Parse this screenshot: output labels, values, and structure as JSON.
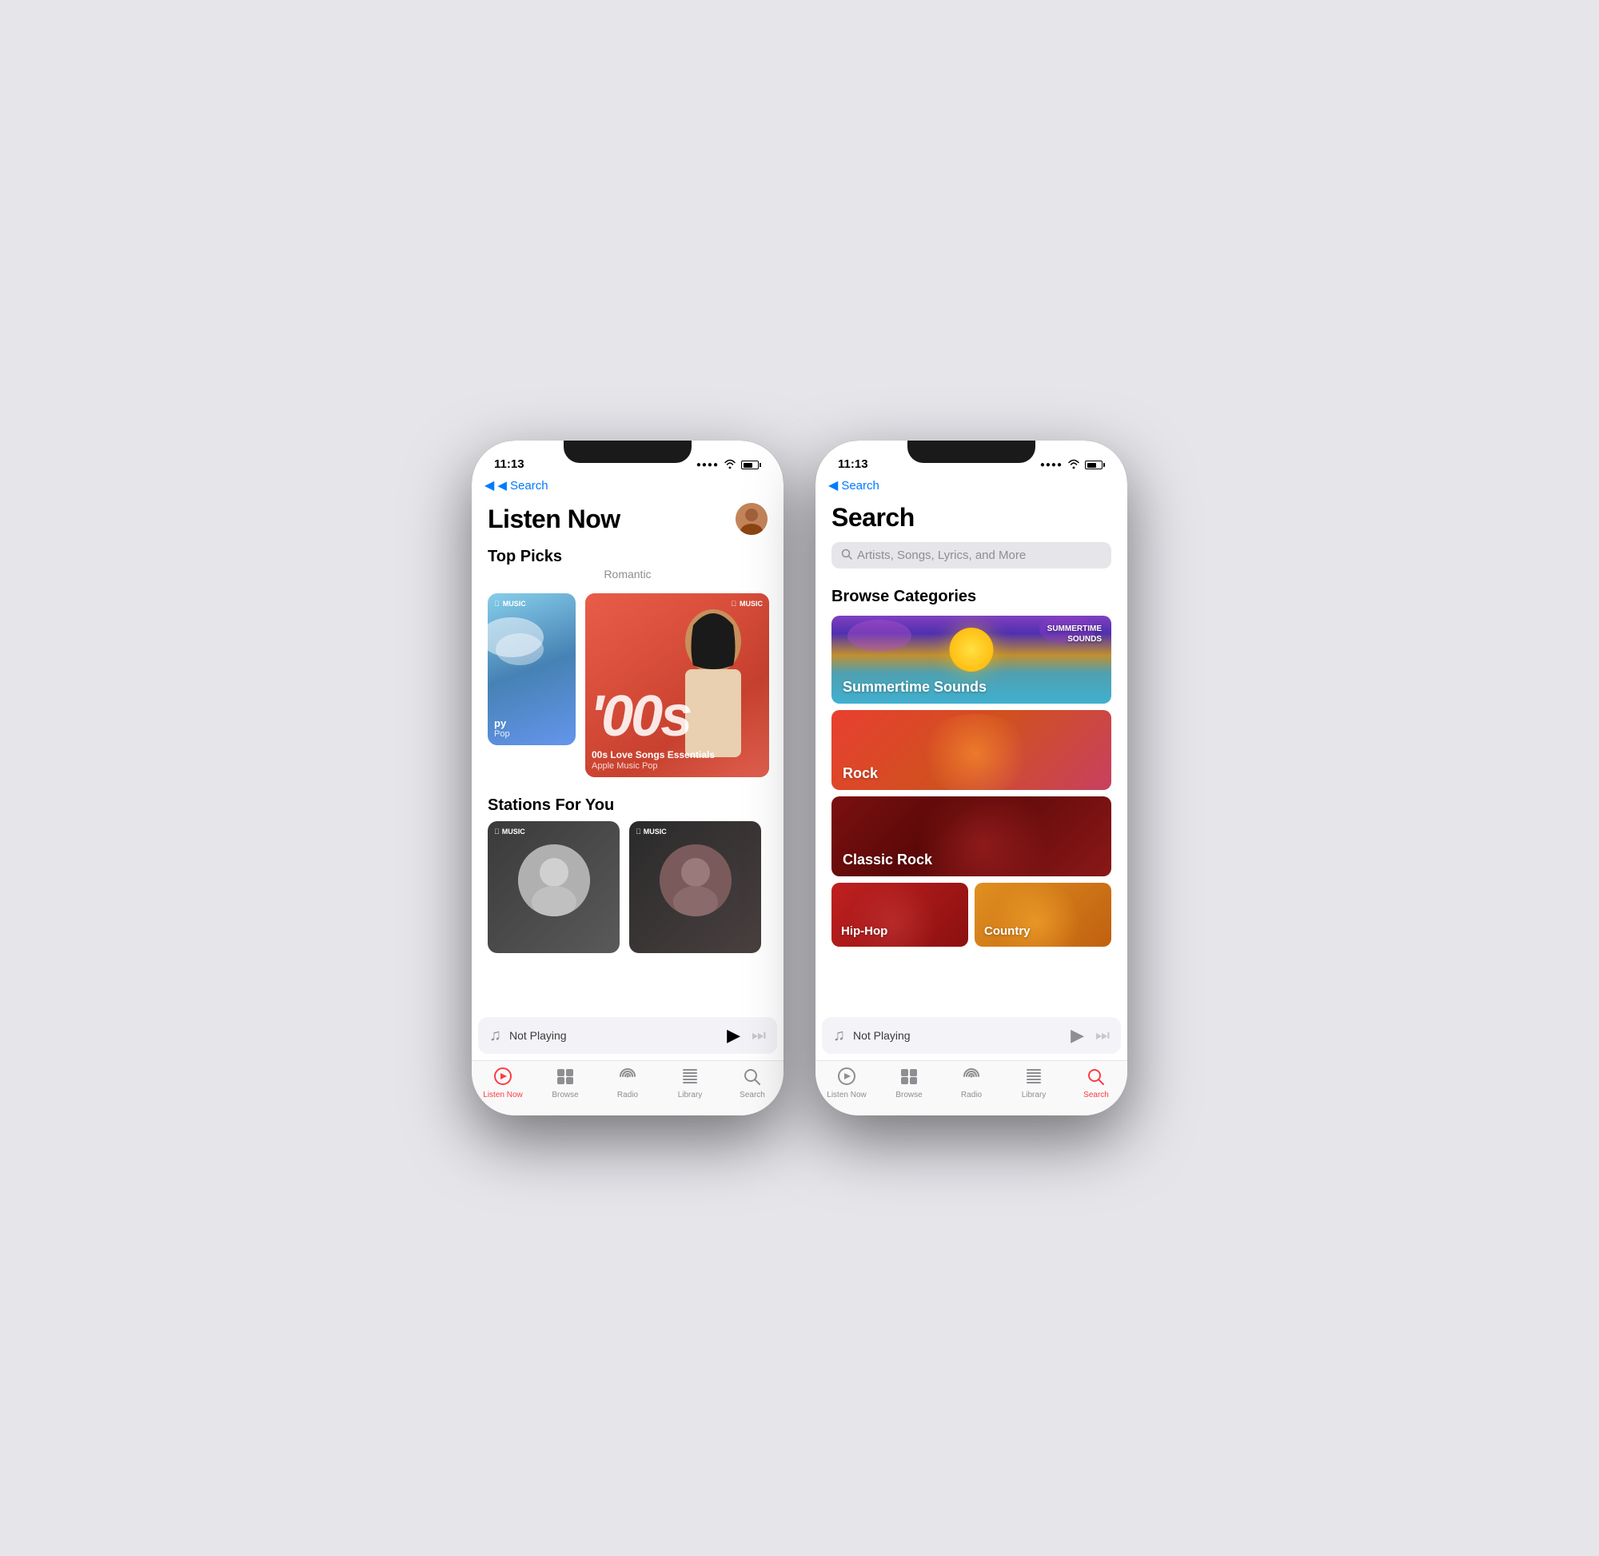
{
  "page": {
    "background": "#e5e5ea"
  },
  "phone_left": {
    "status_bar": {
      "time": "11:13",
      "signal": "●●●●",
      "wifi": "wifi",
      "battery": "battery"
    },
    "back_nav": "◀ Search",
    "screen": "listen_now",
    "header": {
      "title": "Listen Now",
      "avatar_label": "user avatar"
    },
    "top_picks": {
      "section_title": "Top Picks",
      "subtitle": "Romantic",
      "cards": [
        {
          "type": "small",
          "label": "py",
          "sublabel": "Pop",
          "badge": "MUSIC"
        },
        {
          "type": "large",
          "title": "00s Love Songs Essentials",
          "subtitle": "Apple Music Pop",
          "badge": "MUSIC",
          "overlay_text": "'00s"
        }
      ]
    },
    "stations": {
      "section_title": "Stations For You",
      "cards": [
        {
          "badge": "MUSIC"
        },
        {
          "badge": "MUSIC"
        }
      ]
    },
    "now_playing": {
      "text": "Not Playing",
      "play_icon": "▶",
      "skip_icon": "▶▶"
    },
    "tab_bar": {
      "items": [
        {
          "icon": "▶",
          "label": "Listen Now",
          "active": true
        },
        {
          "icon": "⊞",
          "label": "Browse",
          "active": false
        },
        {
          "icon": "((()))",
          "label": "Radio",
          "active": false
        },
        {
          "icon": "≡",
          "label": "Library",
          "active": false
        },
        {
          "icon": "⌕",
          "label": "Search",
          "active": false
        }
      ]
    }
  },
  "phone_right": {
    "status_bar": {
      "time": "11:13",
      "signal": "●●●●",
      "wifi": "wifi",
      "battery": "battery"
    },
    "back_nav": "◀ Search",
    "screen": "search",
    "header": {
      "title": "Search"
    },
    "search_input": {
      "placeholder": "Artists, Songs, Lyrics, and More"
    },
    "browse_categories": {
      "section_title": "Browse Categories",
      "categories": [
        {
          "name": "Summertime Sounds",
          "type": "wide",
          "badge": "SUMMERTIME\nSOUNDS"
        },
        {
          "name": "Rock",
          "type": "wide"
        },
        {
          "name": "Classic Rock",
          "type": "wide"
        },
        {
          "name": "Hip-Hop",
          "type": "half"
        },
        {
          "name": "Country",
          "type": "half"
        }
      ]
    },
    "now_playing": {
      "text": "Not Playing",
      "play_icon": "▶",
      "skip_icon": "▶▶"
    },
    "tab_bar": {
      "items": [
        {
          "icon": "▶",
          "label": "Listen Now",
          "active": false
        },
        {
          "icon": "⊞",
          "label": "Browse",
          "active": false
        },
        {
          "icon": "((()))",
          "label": "Radio",
          "active": false
        },
        {
          "icon": "≡",
          "label": "Library",
          "active": false
        },
        {
          "icon": "⌕",
          "label": "Search",
          "active": true
        }
      ]
    }
  }
}
